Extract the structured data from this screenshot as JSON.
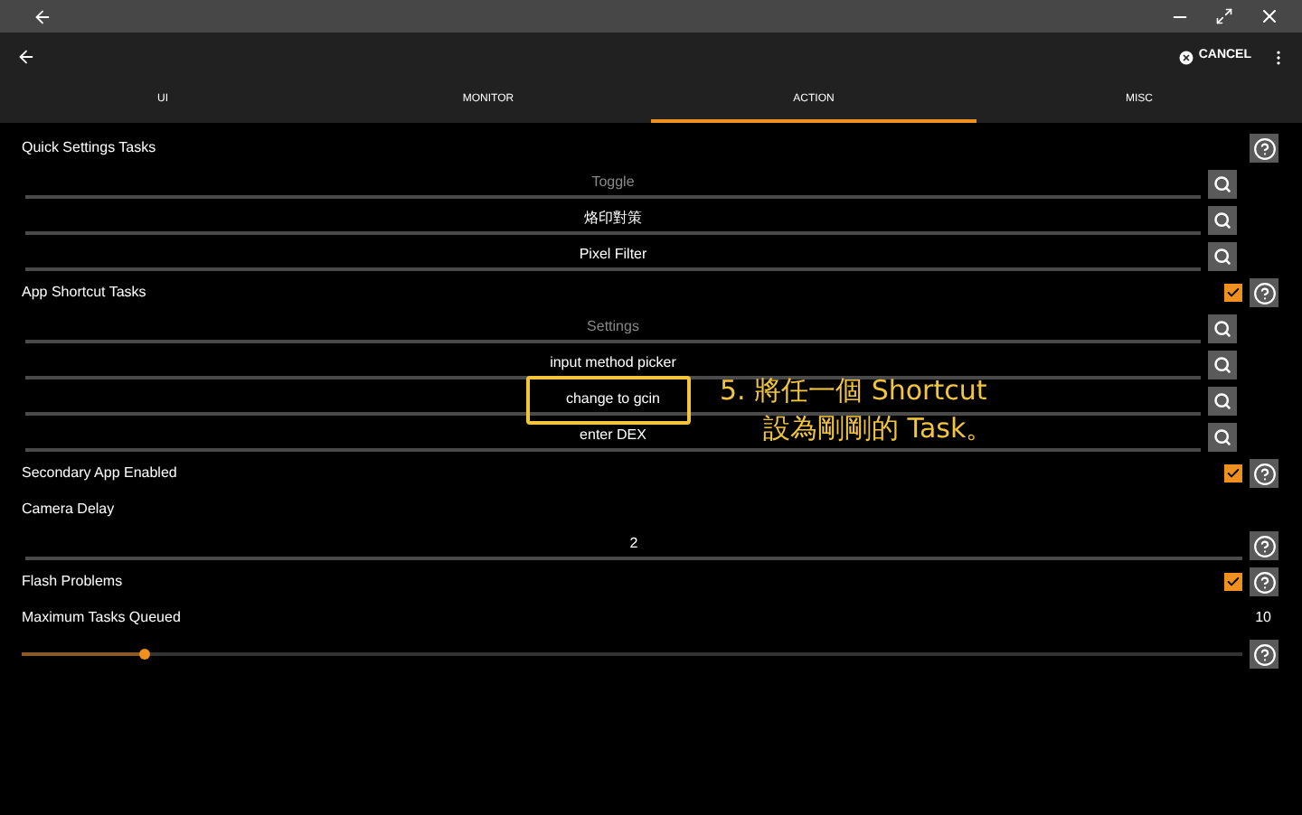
{
  "app_bar": {
    "cancel": "CANCEL"
  },
  "tabs": [
    {
      "label": "UI",
      "selected": false
    },
    {
      "label": "MONITOR",
      "selected": false
    },
    {
      "label": "ACTION",
      "selected": true
    },
    {
      "label": "MISC",
      "selected": false
    }
  ],
  "settings": [
    {
      "kind": "tasks",
      "label": "Quick Settings Tasks",
      "fields": [
        {
          "placeholder": "Toggle"
        },
        {
          "value": "烙印對策"
        },
        {
          "value": "Pixel Filter"
        }
      ]
    },
    {
      "kind": "tasks",
      "label": "App Shortcut Tasks",
      "checked": true,
      "fields": [
        {
          "placeholder": "Settings"
        },
        {
          "value": "input method picker"
        },
        {
          "value": "change to gcin"
        },
        {
          "value": "enter DEX"
        }
      ]
    },
    {
      "kind": "checkbox",
      "label": "Secondary App Enabled",
      "checked": true
    },
    {
      "kind": "number",
      "label": "Camera Delay",
      "value": "2"
    },
    {
      "kind": "checkbox",
      "label": "Flash Problems",
      "checked": true
    },
    {
      "kind": "slider",
      "label": "Maximum Tasks Queued",
      "reading": "10",
      "level": 0.1
    }
  ],
  "annotation": {
    "lines": [
      "5. 將任一個 Shortcut",
      "設為剛剛的 Task。"
    ]
  }
}
